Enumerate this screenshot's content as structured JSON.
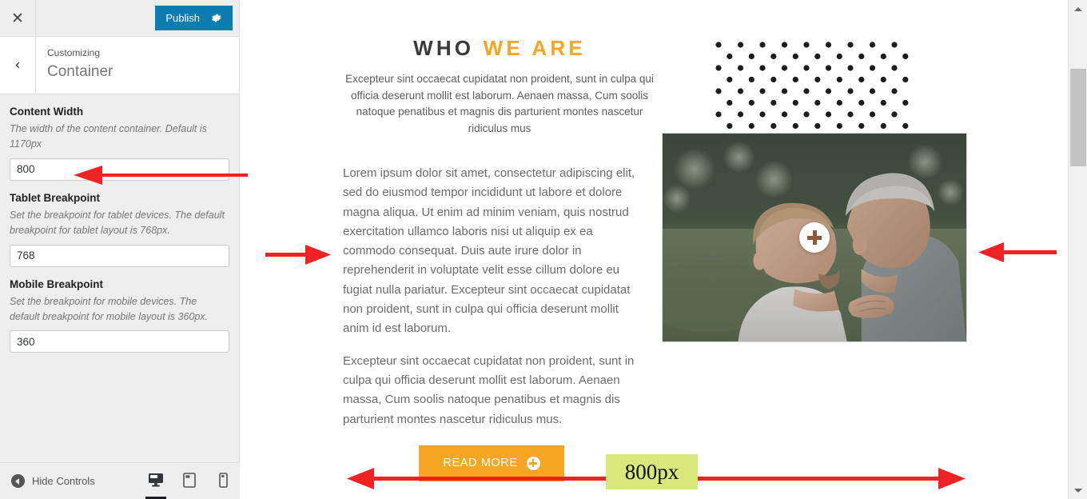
{
  "customizer": {
    "close_icon": "close-icon",
    "publish_label": "Publish",
    "gear_icon": "gear-icon",
    "back_icon": "chevron-left-icon",
    "breadcrumb": "Customizing",
    "panel_title": "Container",
    "controls": [
      {
        "label": "Content Width",
        "description": "The width of the content container. Default is 1170px",
        "value": "800",
        "name": "content-width"
      },
      {
        "label": "Tablet Breakpoint",
        "description": "Set the breakpoint for tablet devices. The default breakpoint for tablet layout is 768px.",
        "value": "768",
        "name": "tablet-breakpoint"
      },
      {
        "label": "Mobile Breakpoint",
        "description": "Set the breakpoint for mobile devices. The default breakpoint for mobile layout is 360px.",
        "value": "360",
        "name": "mobile-breakpoint"
      }
    ],
    "footer": {
      "hide_controls_label": "Hide Controls",
      "collapse_icon": "collapse-icon",
      "devices": [
        {
          "name": "desktop",
          "icon": "desktop-icon",
          "active": true
        },
        {
          "name": "tablet",
          "icon": "tablet-icon",
          "active": false
        },
        {
          "name": "mobile",
          "icon": "mobile-icon",
          "active": false
        }
      ]
    }
  },
  "preview": {
    "heading": {
      "part_dark": "WHO",
      "part_accent": "WE ARE"
    },
    "subheading": "Excepteur sint occaecat cupidatat non proident, sunt in culpa qui officia deserunt mollit est laborum. Aenaen massa, Cum soolis natoque penatibus et magnis dis parturient montes nascetur ridiculus mus",
    "paragraph_1": "Lorem ipsum dolor sit amet, consectetur adipiscing elit, sed do eiusmod tempor incididunt ut labore et dolore magna aliqua. Ut enim ad minim veniam, quis nostrud exercitation ullamco laboris nisi ut aliquip ex ea commodo consequat. Duis aute irure dolor in reprehenderit in voluptate velit esse cillum dolore eu fugiat nulla pariatur. Excepteur sint occaecat cupidatat non proident, sunt in culpa qui officia deserunt mollit anim id est laborum.",
    "paragraph_2": "Excepteur sint occaecat cupidatat non proident, sunt in culpa qui officia deserunt mollit est laborum. Aenaen massa, Cum soolis natoque penatibus et magnis dis parturient montes nascetur ridiculus mus.",
    "read_more_label": "READ MORE",
    "read_more_icon": "plus-circle-icon",
    "dots_decoration": "dot-grid-pattern",
    "photo_overlay_icon": "plus-icon",
    "photo_alt": "two men embracing outdoors"
  },
  "annotations": {
    "width_label": "800px",
    "arrows": [
      {
        "name": "arrow-to-content-width-input",
        "direction": "left"
      },
      {
        "name": "arrow-to-content-left-edge",
        "direction": "right"
      },
      {
        "name": "arrow-to-content-right-edge",
        "direction": "left"
      },
      {
        "name": "measure-arrow-left",
        "direction": "left"
      },
      {
        "name": "measure-arrow-right",
        "direction": "right"
      }
    ]
  },
  "colors": {
    "publish_blue": "#0c7db1",
    "accent_orange": "#f5a623",
    "annotation_red": "#ee2222",
    "label_green": "#d9e87a"
  },
  "scrollbar": {
    "up_icon": "scroll-up-arrow-icon",
    "down_icon": "scroll-down-arrow-icon",
    "thumb": "scroll-thumb"
  }
}
